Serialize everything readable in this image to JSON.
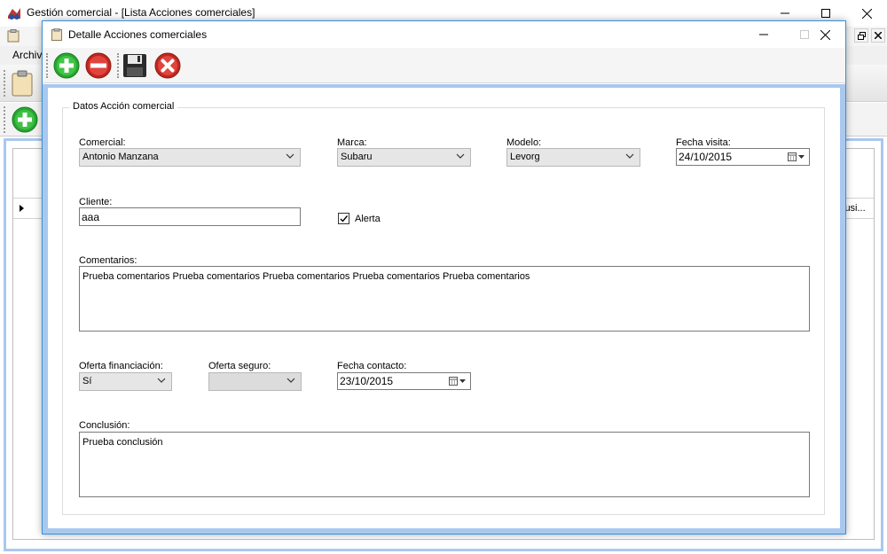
{
  "main_window": {
    "title": "Gestión comercial - [Lista Acciones comerciales]",
    "menu_archivo": "Archiv",
    "grid_cell_partial": "lusi..."
  },
  "dialog": {
    "title": "Detalle Acciones comerciales",
    "toolbar": [
      "add-icon",
      "remove-icon",
      "save-icon",
      "cancel-icon"
    ],
    "group_title": "Datos Acción comercial",
    "comercial": {
      "label": "Comercial:",
      "value": "Antonio Manzana"
    },
    "marca": {
      "label": "Marca:",
      "value": "Subaru"
    },
    "modelo": {
      "label": "Modelo:",
      "value": "Levorg"
    },
    "fecha_visita": {
      "label": "Fecha visita:",
      "value": "24/10/2015"
    },
    "cliente": {
      "label": "Cliente:",
      "value": "aaa"
    },
    "alerta": {
      "label": "Alerta",
      "checked": true
    },
    "comentarios": {
      "label": "Comentarios:",
      "value": "Prueba comentarios Prueba comentarios Prueba comentarios Prueba comentarios Prueba comentarios"
    },
    "oferta_financiacion": {
      "label": "Oferta financiación:",
      "value": "Sí"
    },
    "oferta_seguro": {
      "label": "Oferta seguro:",
      "value": ""
    },
    "fecha_contacto": {
      "label": "Fecha contacto:",
      "value": "23/10/2015"
    },
    "conclusion": {
      "label": "Conclusión:",
      "value": "Prueba conclusión"
    }
  },
  "colors": {
    "accent": "#3c8fd8",
    "frame": "#a9c8ef",
    "add_green": "#27a82f",
    "remove_red": "#d9302a"
  }
}
